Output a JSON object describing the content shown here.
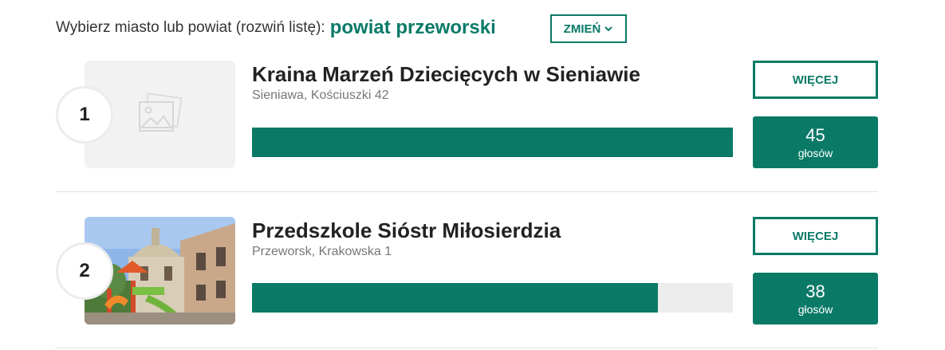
{
  "header": {
    "prompt": "Wybierz miasto lub powiat (rozwiń listę):",
    "region": "powiat przeworski",
    "change_label": "ZMIEŃ"
  },
  "entries": [
    {
      "rank": "1",
      "name": "Kraina Marzeń Dziecięcych w Sieniawie",
      "address": "Sieniawa, Kościuszki 42",
      "votes": "45",
      "votes_label": "głosów",
      "more_label": "WIĘCEJ",
      "progress": 1.0,
      "image": "placeholder-image-icon"
    },
    {
      "rank": "2",
      "name": "Przedszkole Sióstr Miłosierdzia",
      "address": "Przeworsk, Krakowska 1",
      "votes": "38",
      "votes_label": "głosów",
      "more_label": "WIĘCEJ",
      "progress": 0.844,
      "image": "photo-building-playground"
    }
  ],
  "colors": {
    "accent": "#0a7a67",
    "track": "#ededed",
    "divider": "#e2e2e2"
  }
}
